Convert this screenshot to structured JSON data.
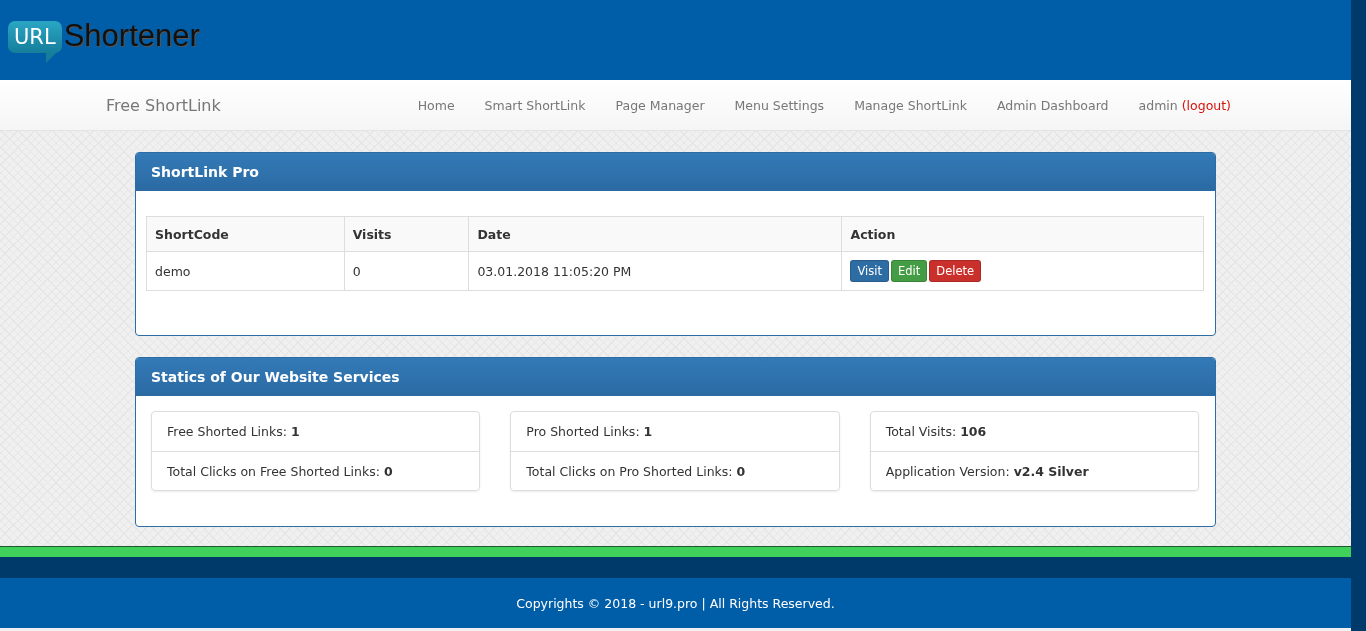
{
  "logo": {
    "badge": "URL",
    "wordmark": "Shortener"
  },
  "navbar": {
    "brand": "Free ShortLink",
    "links": [
      "Home",
      "Smart ShortLink",
      "Page Manager",
      "Menu Settings",
      "Manage ShortLink",
      "Admin Dashboard"
    ],
    "user": "admin",
    "logout": "(logout)"
  },
  "links_panel": {
    "title": "ShortLink Pro",
    "columns": [
      "ShortCode",
      "Visits",
      "Date",
      "Action"
    ],
    "rows": [
      {
        "shortcode": "demo",
        "visits": "0",
        "date": "03.01.2018 11:05:20 PM",
        "actions": [
          {
            "kind": "primary",
            "label": "Visit"
          },
          {
            "kind": "success",
            "label": "Edit"
          },
          {
            "kind": "danger",
            "label": "Delete"
          }
        ]
      }
    ]
  },
  "stats_panel": {
    "title": "Statics of Our Website Services",
    "groups": [
      [
        {
          "label": "Free Shorted Links:",
          "value": "1"
        },
        {
          "label": "Total Clicks on Free Shorted Links:",
          "value": "0"
        }
      ],
      [
        {
          "label": "Pro Shorted Links:",
          "value": "1"
        },
        {
          "label": "Total Clicks on Pro Shorted Links:",
          "value": "0"
        }
      ],
      [
        {
          "label": "Total Visits:",
          "value": "106"
        },
        {
          "label": "Application Version:",
          "value": "v2.4 Silver"
        }
      ]
    ]
  },
  "footer": {
    "text": "Copyrights © 2018 - url9.pro | All Rights Reserved."
  }
}
